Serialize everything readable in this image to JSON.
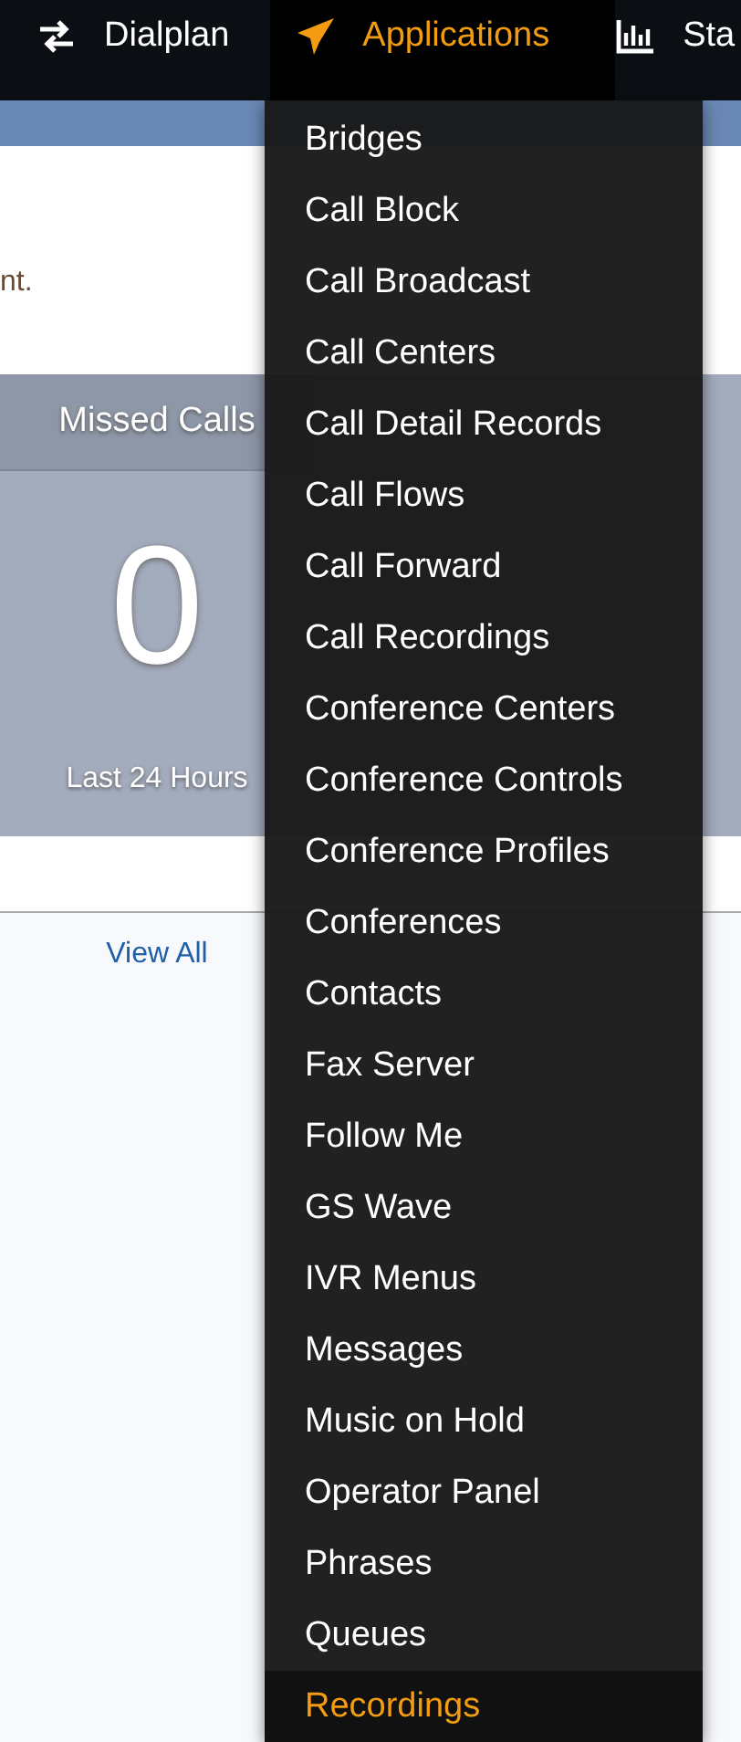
{
  "navbar": {
    "items": [
      {
        "label": "Dialplan",
        "selected": false
      },
      {
        "label": "Applications",
        "selected": true
      },
      {
        "label": "Sta",
        "selected": false
      }
    ]
  },
  "message": {
    "text": "nt."
  },
  "card": {
    "title": "Missed Calls",
    "value": "0",
    "caption": "Last 24 Hours",
    "link": "View All"
  },
  "applications_menu": {
    "items": [
      {
        "label": "Bridges",
        "selected": false
      },
      {
        "label": "Call Block",
        "selected": false
      },
      {
        "label": "Call Broadcast",
        "selected": false
      },
      {
        "label": "Call Centers",
        "selected": false
      },
      {
        "label": "Call Detail Records",
        "selected": false
      },
      {
        "label": "Call Flows",
        "selected": false
      },
      {
        "label": "Call Forward",
        "selected": false
      },
      {
        "label": "Call Recordings",
        "selected": false
      },
      {
        "label": "Conference Centers",
        "selected": false
      },
      {
        "label": "Conference Controls",
        "selected": false
      },
      {
        "label": "Conference Profiles",
        "selected": false
      },
      {
        "label": "Conferences",
        "selected": false
      },
      {
        "label": "Contacts",
        "selected": false
      },
      {
        "label": "Fax Server",
        "selected": false
      },
      {
        "label": "Follow Me",
        "selected": false
      },
      {
        "label": "GS Wave",
        "selected": false
      },
      {
        "label": "IVR Menus",
        "selected": false
      },
      {
        "label": "Messages",
        "selected": false
      },
      {
        "label": "Music on Hold",
        "selected": false
      },
      {
        "label": "Operator Panel",
        "selected": false
      },
      {
        "label": "Phrases",
        "selected": false
      },
      {
        "label": "Queues",
        "selected": false
      },
      {
        "label": "Recordings",
        "selected": true
      }
    ]
  }
}
